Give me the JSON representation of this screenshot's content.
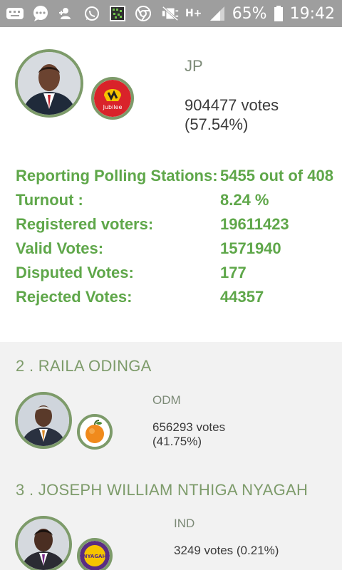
{
  "statusbar": {
    "battery": "65%",
    "time": "19:42",
    "network": "H+",
    "icons": [
      "keyboard-icon",
      "chat-icon",
      "person-add-icon",
      "whatsapp-icon",
      "app-icon",
      "chrome-icon",
      "mute-icon",
      "signal-icon",
      "battery-icon"
    ]
  },
  "top_candidate": {
    "party": "JP",
    "votes": "904477 votes",
    "percent": "(57.54%)",
    "party_logo_text": "Jubilee"
  },
  "stats": [
    {
      "label": "Reporting Polling Stations:",
      "value": "5455 out of 408"
    },
    {
      "label": "Turnout :",
      "value": "8.24 %"
    },
    {
      "label": "Registered voters:",
      "value": "19611423"
    },
    {
      "label": "Valid Votes:",
      "value": "1571940"
    },
    {
      "label": "Disputed Votes:",
      "value": "177"
    },
    {
      "label": "Rejected Votes:",
      "value": "44357"
    }
  ],
  "candidates": [
    {
      "title": "2 . RAILA ODINGA",
      "party": "ODM",
      "votes": "656293 votes",
      "percent": "(41.75%)"
    },
    {
      "title": "3 . JOSEPH WILLIAM NTHIGA NYAGAH",
      "party": "IND",
      "votes": "3249 votes (0.21%)",
      "logo_text": "NYAGAH"
    }
  ],
  "colors": {
    "accent_green": "#5fa74a",
    "ring_green": "#7d9b6a",
    "statusbar": "#9e9e9e"
  }
}
